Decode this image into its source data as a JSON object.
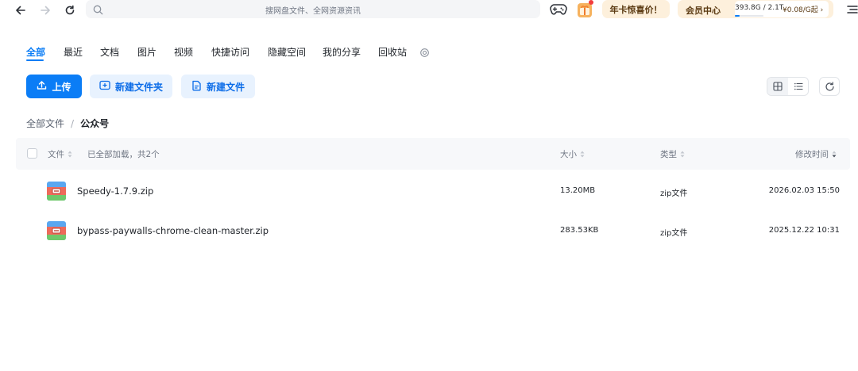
{
  "topbar": {
    "search_placeholder": "搜网盘文件、全网资源资讯",
    "promo_label": "年卡惊喜价！",
    "vip_label": "会员中心",
    "storage_text": "393.8G / 2.1T",
    "storage_price": "¥0.08/G起 ›",
    "storage_fraction": 0.18
  },
  "tabs": [
    {
      "label": "全部"
    },
    {
      "label": "最近"
    },
    {
      "label": "文档"
    },
    {
      "label": "图片"
    },
    {
      "label": "视频"
    },
    {
      "label": "快捷访问"
    },
    {
      "label": "隐藏空间"
    },
    {
      "label": "我的分享"
    },
    {
      "label": "回收站"
    }
  ],
  "toolbar": {
    "upload_label": "上传",
    "new_folder_label": "新建文件夹",
    "new_file_label": "新建文件"
  },
  "breadcrumb": {
    "root": "全部文件",
    "separator": "/",
    "current": "公众号"
  },
  "table": {
    "col_file": "文件",
    "loaded_note": "已全部加载，共2个",
    "col_size": "大小",
    "col_type": "类型",
    "col_modified": "修改时间",
    "rows": [
      {
        "name": "Speedy-1.7.9.zip",
        "size": "13.20MB",
        "type": "zip文件",
        "modified": "2026.02.03 15:50"
      },
      {
        "name": "bypass-paywalls-chrome-clean-master.zip",
        "size": "283.53KB",
        "type": "zip文件",
        "modified": "2025.12.22 10:31"
      }
    ]
  },
  "colors": {
    "accent": "#0b7df6",
    "accent_light_bg": "#e8f2fe",
    "promo_bg": "#fdf0dc",
    "badge_red": "#f23c3c"
  },
  "icons": [
    "back-arrow-icon",
    "forward-arrow-icon",
    "reload-icon",
    "search-icon",
    "gamepad-icon",
    "gift-icon",
    "menu-icon",
    "settings-gear-icon",
    "upload-icon",
    "new-folder-icon",
    "new-file-icon",
    "grid-view-icon",
    "list-view-icon",
    "refresh-icon",
    "zip-file-icon",
    "sort-icon"
  ]
}
